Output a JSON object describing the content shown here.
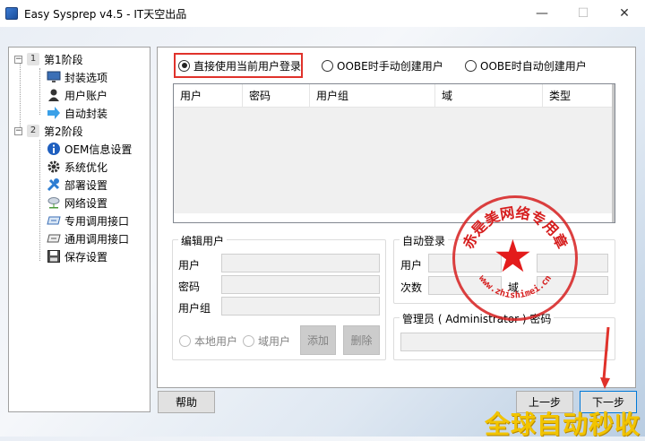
{
  "window": {
    "title": "Easy Sysprep v4.5 - IT天空出品",
    "controls": [
      "—",
      "☐",
      "✕"
    ]
  },
  "tree": {
    "stage1": {
      "badge": "1",
      "label": "第1阶段",
      "expander": "−"
    },
    "stage1_items": [
      "封装选项",
      "用户账户",
      "自动封装"
    ],
    "stage2": {
      "badge": "2",
      "label": "第2阶段",
      "expander": "−"
    },
    "stage2_items": [
      "OEM信息设置",
      "系统优化",
      "部署设置",
      "网络设置",
      "专用调用接口",
      "通用调用接口",
      "保存设置"
    ]
  },
  "login_mode": {
    "options": [
      "直接使用当前用户登录",
      "OOBE时手动创建用户",
      "OOBE时自动创建用户"
    ],
    "selected": "直接使用当前用户登录"
  },
  "user_table": {
    "columns": [
      "用户",
      "密码",
      "用户组",
      "域",
      "类型"
    ],
    "rows": []
  },
  "edit_user": {
    "legend": "编辑用户",
    "user_label": "用户",
    "password_label": "密码",
    "group_label": "用户组",
    "local_user_label": "本地用户",
    "domain_user_label": "域用户",
    "add_button": "添加",
    "delete_button": "删除"
  },
  "auto_login": {
    "legend": "自动登录",
    "user_label": "用户",
    "count_label": "次数",
    "domain_label": "域"
  },
  "admin": {
    "legend": "管理员 ( Administrator ) 密码"
  },
  "footer": {
    "help_button": "帮助",
    "prev_button": "上一步",
    "next_button": "下一步"
  },
  "overlays": {
    "stamp_top": "赤是美网络专用章",
    "stamp_bottom": "www.zhishimei.cn",
    "watermark": "全球自动秒收",
    "stamp_color": "#d61e1e",
    "highlight_color": "#e0322b",
    "watermark_color": "#f2c400"
  }
}
